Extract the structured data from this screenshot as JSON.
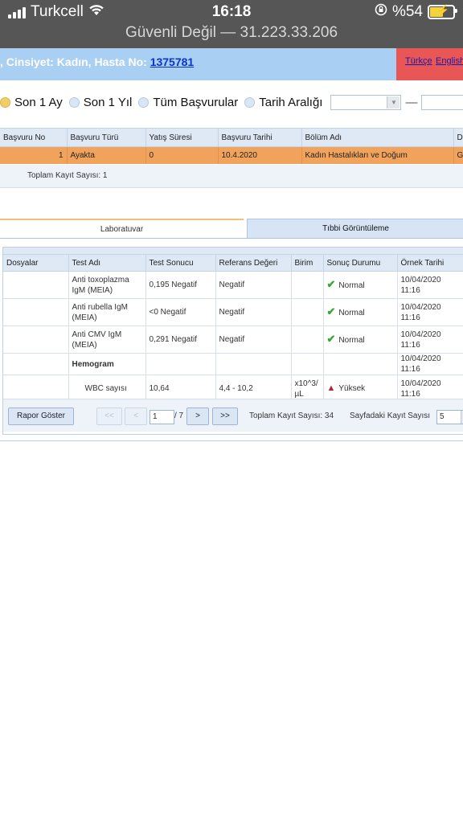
{
  "status_bar": {
    "carrier": "Turkcell",
    "time": "16:18",
    "battery": "%54",
    "address": "Güvenli Değil — 31.223.33.206"
  },
  "header": {
    "patient_info": ", Cinsiyet: Kadın, Hasta No:",
    "patient_no": "1375781",
    "lang_tr": "Türkçe",
    "lang_en": "English"
  },
  "filters": {
    "options": [
      "Son 1 Ay",
      "Son 1 Yıl",
      "Tüm Başvurular",
      "Tarih Aralığı"
    ],
    "selected": "Son 1 Ay",
    "range_separator": "—"
  },
  "applications": {
    "columns": [
      "Başvuru No",
      "Başvuru Türü",
      "Yatış Süresi",
      "Başvuru Tarihi",
      "Bölüm Adı",
      "De"
    ],
    "rows": [
      {
        "no": "1",
        "type": "Ayakta",
        "stay": "0",
        "date": "10.4.2020",
        "dept": "Kadın Hastalıkları ve Doğum",
        "extra": "G"
      }
    ],
    "total": "Toplam Kayıt Sayısı: 1"
  },
  "tabs": {
    "lab": "Laboratuvar",
    "imaging": "Tıbbi Görüntüleme"
  },
  "lab": {
    "columns": [
      "Dosyalar",
      "Test Adı",
      "Test Sonucu",
      "Referans Değeri",
      "Birim",
      "Sonuç Durumu",
      "Örnek Tarihi"
    ],
    "rows": [
      {
        "file": "",
        "test": "Anti toxoplazma IgM (MEIA)",
        "result": "0,195 Negatif",
        "ref": "Negatif",
        "unit": "",
        "status": "Normal",
        "status_icon": "check-icon",
        "date": "10/04/2020 11:16"
      },
      {
        "file": "",
        "test": "Anti rubella IgM (MEIA)",
        "result": "<0 Negatif",
        "ref": "Negatif",
        "unit": "",
        "status": "Normal",
        "status_icon": "check-icon",
        "date": "10/04/2020 11:16"
      },
      {
        "file": "",
        "test": "Anti CMV IgM (MEIA)",
        "result": "0,291 Negatif",
        "ref": "Negatif",
        "unit": "",
        "status": "Normal",
        "status_icon": "check-icon",
        "date": "10/04/2020 11:16"
      },
      {
        "file": "",
        "test": "Hemogram",
        "result": "",
        "ref": "",
        "unit": "",
        "status": "",
        "status_icon": "",
        "date": "10/04/2020 11:16"
      },
      {
        "file": "",
        "test": "WBC sayısı",
        "result": "10,64",
        "ref": "4,4 - 10,2",
        "unit": "x10^3/ µL",
        "status": "Yüksek",
        "status_icon": "arrow-up-icon",
        "date": "10/04/2020 11:16"
      }
    ],
    "report_button": "Rapor Göster",
    "pager": {
      "first": "<<",
      "prev": "<",
      "page": "1",
      "of_pages": "/ 7",
      "next": ">",
      "last": ">>",
      "total": "Toplam Kayıt Sayısı: 34",
      "page_size_label": "Sayfadaki Kayıt Sayısı",
      "page_size": "5"
    }
  }
}
